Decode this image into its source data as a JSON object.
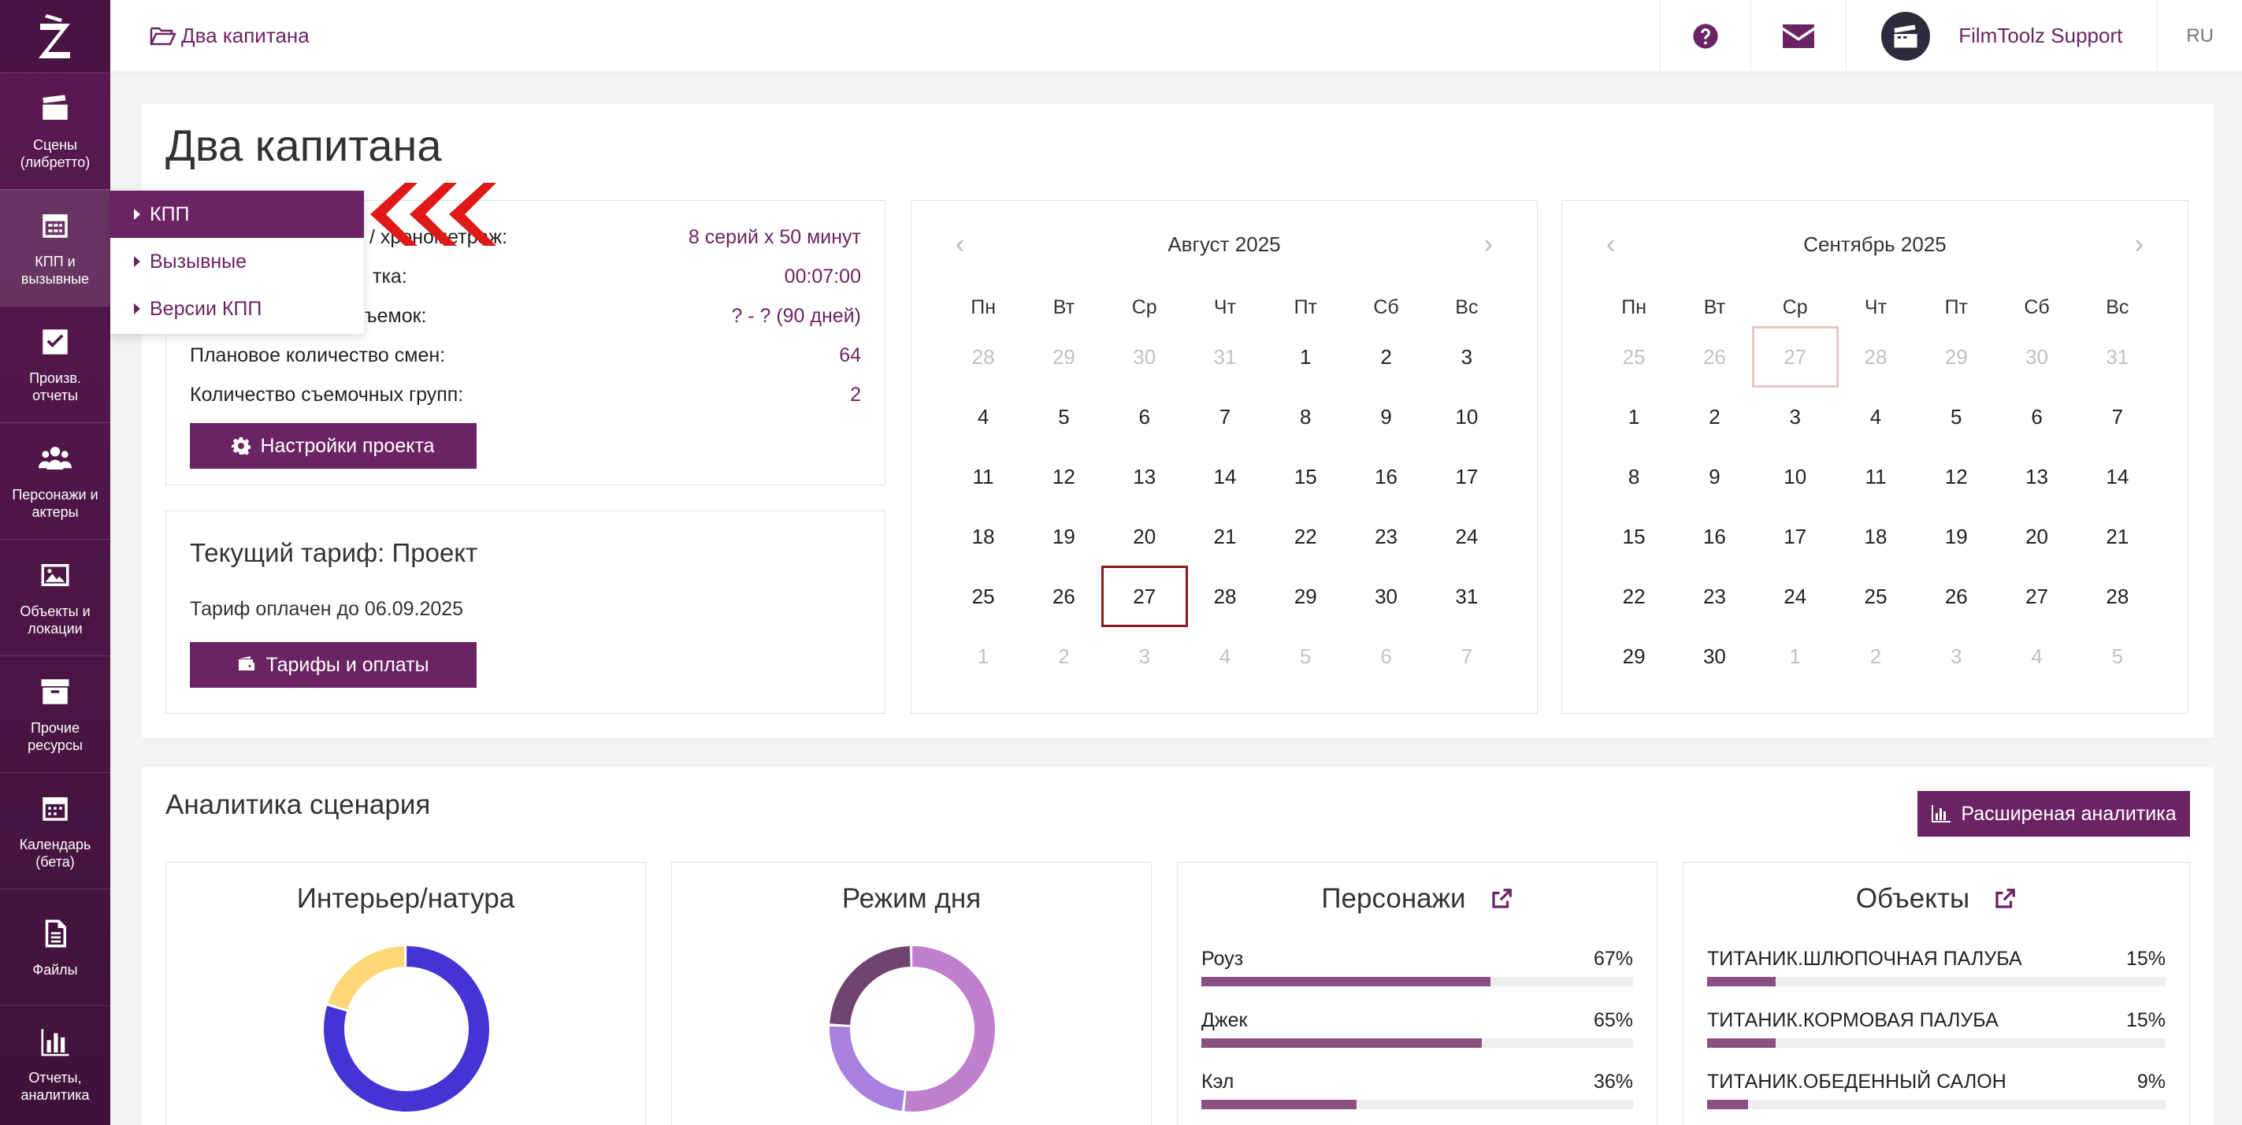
{
  "sidebar": {
    "items": [
      {
        "label": "Сцены (либретто)",
        "icon": "clapperboard-icon"
      },
      {
        "label": "КПП и вызывные",
        "icon": "calendar-grid-icon"
      },
      {
        "label": "Произв. отчеты",
        "icon": "checkbox-icon"
      },
      {
        "label": "Персонажи и актеры",
        "icon": "people-icon"
      },
      {
        "label": "Объекты и локации",
        "icon": "image-icon"
      },
      {
        "label": "Прочие ресурсы",
        "icon": "archive-box-icon"
      },
      {
        "label": "Календарь (бета)",
        "icon": "calendar-icon"
      },
      {
        "label": "Файлы",
        "icon": "file-icon"
      },
      {
        "label": "Отчеты, аналитика",
        "icon": "bar-chart-icon"
      }
    ]
  },
  "topbar": {
    "breadcrumb": "Два капитана",
    "user": "FilmToolz Support",
    "lang": "RU"
  },
  "dropdown": {
    "items": [
      "КПП",
      "Вызывные",
      "Версии КПП"
    ]
  },
  "project": {
    "title": "Два капитана",
    "rows": [
      {
        "label": "/ хронометраж:",
        "value": "8 серий х 50 минут"
      },
      {
        "label": "тка:",
        "value": "00:07:00"
      },
      {
        "label": "ъемок:",
        "value": "? - ? (90 дней)"
      },
      {
        "label": "Плановое количество смен:",
        "value": "64"
      },
      {
        "label": "Количество съемочных групп:",
        "value": "2"
      }
    ],
    "settings_button": "Настройки проекта"
  },
  "tariff": {
    "title": "Текущий тариф: Проект",
    "paid": "Тариф оплачен до 06.09.2025",
    "button": "Тарифы и оплаты"
  },
  "calendars": [
    {
      "month": "Август 2025",
      "weekdays": [
        "Пн",
        "Вт",
        "Ср",
        "Чт",
        "Пт",
        "Сб",
        "Вс"
      ],
      "days": [
        "28",
        "29",
        "30",
        "31",
        "1",
        "2",
        "3",
        "4",
        "5",
        "6",
        "7",
        "8",
        "9",
        "10",
        "11",
        "12",
        "13",
        "14",
        "15",
        "16",
        "17",
        "18",
        "19",
        "20",
        "21",
        "22",
        "23",
        "24",
        "25",
        "26",
        "27",
        "28",
        "29",
        "30",
        "31",
        "1",
        "2",
        "3",
        "4",
        "5",
        "6",
        "7"
      ],
      "muted": [
        0,
        1,
        2,
        3,
        35,
        36,
        37,
        38,
        39,
        40,
        41
      ],
      "highlight": 30
    },
    {
      "month": "Сентябрь 2025",
      "weekdays": [
        "Пн",
        "Вт",
        "Ср",
        "Чт",
        "Пт",
        "Сб",
        "Вс"
      ],
      "days": [
        "25",
        "26",
        "27",
        "28",
        "29",
        "30",
        "31",
        "1",
        "2",
        "3",
        "4",
        "5",
        "6",
        "7",
        "8",
        "9",
        "10",
        "11",
        "12",
        "13",
        "14",
        "15",
        "16",
        "17",
        "18",
        "19",
        "20",
        "21",
        "22",
        "23",
        "24",
        "25",
        "26",
        "27",
        "28",
        "29",
        "30",
        "1",
        "2",
        "3",
        "4",
        "5"
      ],
      "muted": [
        0,
        1,
        2,
        3,
        4,
        5,
        6,
        37,
        38,
        39,
        40,
        41
      ],
      "soft_highlight": 2
    }
  ],
  "analytics": {
    "title": "Аналитика сценария",
    "button": "Расширеная аналитика",
    "interior_title": "Интерьер/натура",
    "interior_segments": [
      {
        "value": 0.8,
        "color": "#4434d4"
      },
      {
        "value": 0.2,
        "color": "#fdd874"
      }
    ],
    "day_title": "Режим дня",
    "day_segments": [
      {
        "value": 0.52,
        "color": "#c07fcc"
      },
      {
        "value": 0.24,
        "color": "#a881e0"
      },
      {
        "value": 0.24,
        "color": "#6f4570"
      }
    ],
    "characters_title": "Персонажи",
    "characters": [
      {
        "name": "Роуз",
        "pct": "67%",
        "value": 67
      },
      {
        "name": "Джек",
        "pct": "65%",
        "value": 65
      },
      {
        "name": "Кэл",
        "pct": "36%",
        "value": 36
      }
    ],
    "objects_title": "Объекты",
    "objects": [
      {
        "name": "ТИТАНИК.ШЛЮПОЧНАЯ ПАЛУБА",
        "pct": "15%",
        "value": 15
      },
      {
        "name": "ТИТАНИК.КОРМОВАЯ ПАЛУБА",
        "pct": "15%",
        "value": 15
      },
      {
        "name": "ТИТАНИК.ОБЕДЕННЫЙ САЛОН",
        "pct": "9%",
        "value": 9
      }
    ]
  },
  "colors": {
    "brand": "#6b2463",
    "today": "#8b1a1a"
  }
}
